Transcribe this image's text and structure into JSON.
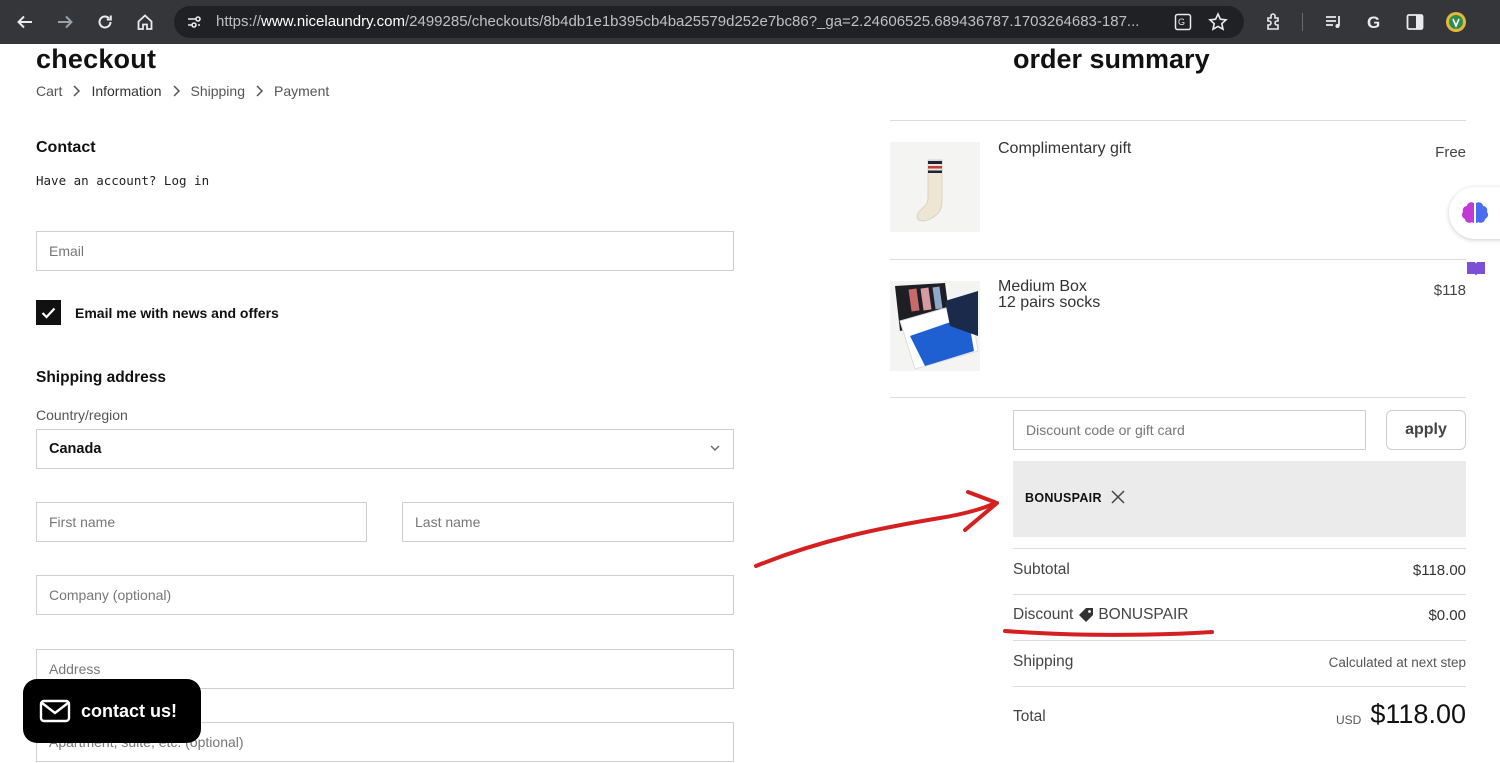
{
  "browser": {
    "url_prefix": "https://",
    "url_host": "www.nicelaundry.com",
    "url_path": "/2499285/checkouts/8b4db1e1b395cb4ba25579d252e7bc86?_ga=2.24606525.689436787.1703264683-187..."
  },
  "checkout": {
    "title": "checkout",
    "breadcrumbs": [
      "Cart",
      "Information",
      "Shipping",
      "Payment"
    ],
    "contact_heading": "Contact",
    "have_account": "Have an account? Log in",
    "email_placeholder": "Email",
    "newsletter_label": "Email me with news and offers",
    "newsletter_checked": true,
    "shipping_heading": "Shipping address",
    "country_label": "Country/region",
    "country_value": "Canada",
    "first_name_placeholder": "First name",
    "last_name_placeholder": "Last name",
    "company_placeholder": "Company (optional)",
    "address_placeholder": "Address",
    "apartment_placeholder": "Apartment, suite, etc. (optional)"
  },
  "contact_button": {
    "label": "contact us!"
  },
  "summary": {
    "title": "order summary",
    "items": [
      {
        "name": "Complimentary gift",
        "variant": "",
        "price": "Free",
        "thumbnail": "sock-icon"
      },
      {
        "name": "Medium Box",
        "variant": "12 pairs socks",
        "price": "$118",
        "thumbnail": "sock-box-icon"
      }
    ],
    "discount_placeholder": "Discount code or gift card",
    "apply_label": "apply",
    "applied_code": "BONUSPAIR",
    "subtotal_label": "Subtotal",
    "subtotal_value": "$118.00",
    "discount_label": "Discount",
    "discount_code": "BONUSPAIR",
    "discount_value": "$0.00",
    "shipping_label": "Shipping",
    "shipping_value": "Calculated at next step",
    "total_label": "Total",
    "total_currency": "USD",
    "total_value": "$118.00"
  },
  "colors": {
    "annotation_red": "#d42020",
    "browser_bar": "#35363a",
    "primary_text": "#111111"
  }
}
